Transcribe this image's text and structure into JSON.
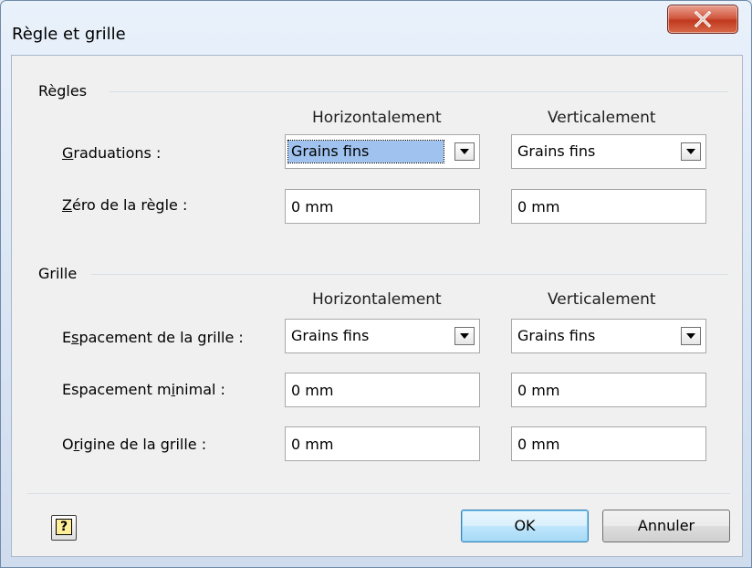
{
  "window": {
    "title": "Règle et grille"
  },
  "regles": {
    "group_label": "Règles",
    "col_horizontal": "Horizontalement",
    "col_vertical": "Verticalement",
    "graduations": {
      "label_accel": "G",
      "label_rest": "raduations :",
      "horizontal": "Grains fins",
      "vertical": "Grains fins"
    },
    "zero": {
      "label_accel": "Z",
      "label_rest": "éro de la règle :",
      "horizontal": "0 mm",
      "vertical": "0 mm"
    }
  },
  "grille": {
    "group_label": "Grille",
    "col_horizontal": "Horizontalement",
    "col_vertical": "Verticalement",
    "espacement": {
      "label_pre": "E",
      "label_accel": "s",
      "label_rest": "pacement de la grille :",
      "horizontal": "Grains fins",
      "vertical": "Grains fins"
    },
    "espacement_min": {
      "label_pre": "Espacement m",
      "label_accel": "i",
      "label_rest": "nimal :",
      "horizontal": "0 mm",
      "vertical": "0 mm"
    },
    "origine": {
      "label_pre": "O",
      "label_accel": "r",
      "label_rest": "igine de la grille :",
      "horizontal": "0 mm",
      "vertical": "0 mm"
    }
  },
  "buttons": {
    "help": "?",
    "ok": "OK",
    "cancel": "Annuler"
  },
  "icons": {
    "close": "close-icon",
    "help": "help-icon",
    "dropdown": "chevron-down-icon"
  },
  "colors": {
    "selection": "#9fc2ee",
    "close_button": "#c0391f",
    "ok_border": "#3c7fb1"
  }
}
